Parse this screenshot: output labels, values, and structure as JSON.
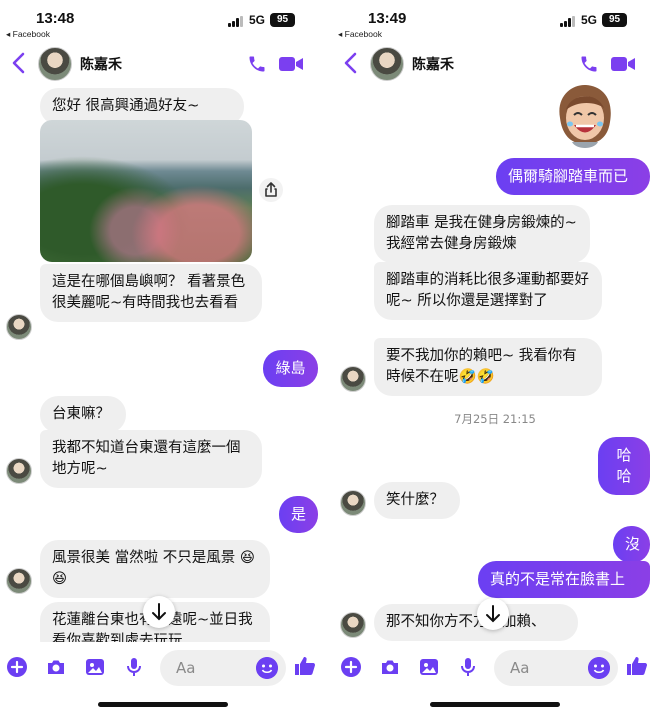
{
  "left": {
    "status": {
      "time": "13:48",
      "back_app": "◂ Facebook",
      "network": "5G",
      "battery": "95"
    },
    "header": {
      "contact_name": "陈嘉禾"
    },
    "messages": [
      "您好  很高興通過好友~",
      "這是在哪個島嶼啊？  看著景色很美麗呢~有時間我也去看看",
      "綠島",
      "台東嘛？",
      "我都不知道台東還有這麼一個地方呢~",
      "是",
      "風景很美  當然啦  不只是風景 😆😆",
      "花蓮離台東也有很遠呢~並日我看你喜歡到處去玩玩"
    ],
    "composer": {
      "placeholder": "Aa"
    }
  },
  "right": {
    "status": {
      "time": "13:49",
      "back_app": "◂ Facebook",
      "network": "5G",
      "battery": "95"
    },
    "header": {
      "contact_name": "陈嘉禾"
    },
    "messages": [
      "偶爾騎腳踏車而已",
      "腳踏車  是我在健身房鍛煉的~  我經常去健身房鍛煉",
      "腳踏車的消耗比很多運動都要好呢~  所以你還是選擇對了",
      "要不我加你的賴吧~  我看你有時候不在呢🤣🤣",
      "哈哈",
      "笑什麼？",
      "沒",
      "真的不是常在臉書上",
      "那不知你方不方便加賴、"
    ],
    "date_separator": "7月25日 21:15",
    "composer": {
      "placeholder": "Aa"
    }
  },
  "colors": {
    "accent": "#7b3ff0",
    "bubble_other": "#efefef",
    "bubble_me": "#6b3ff2"
  },
  "icons": [
    "back-chevron-icon",
    "phone-icon",
    "video-camera-icon",
    "share-icon",
    "arrow-down-icon",
    "plus-icon",
    "camera-icon",
    "image-icon",
    "microphone-icon",
    "emoji-icon",
    "thumbs-up-icon"
  ]
}
